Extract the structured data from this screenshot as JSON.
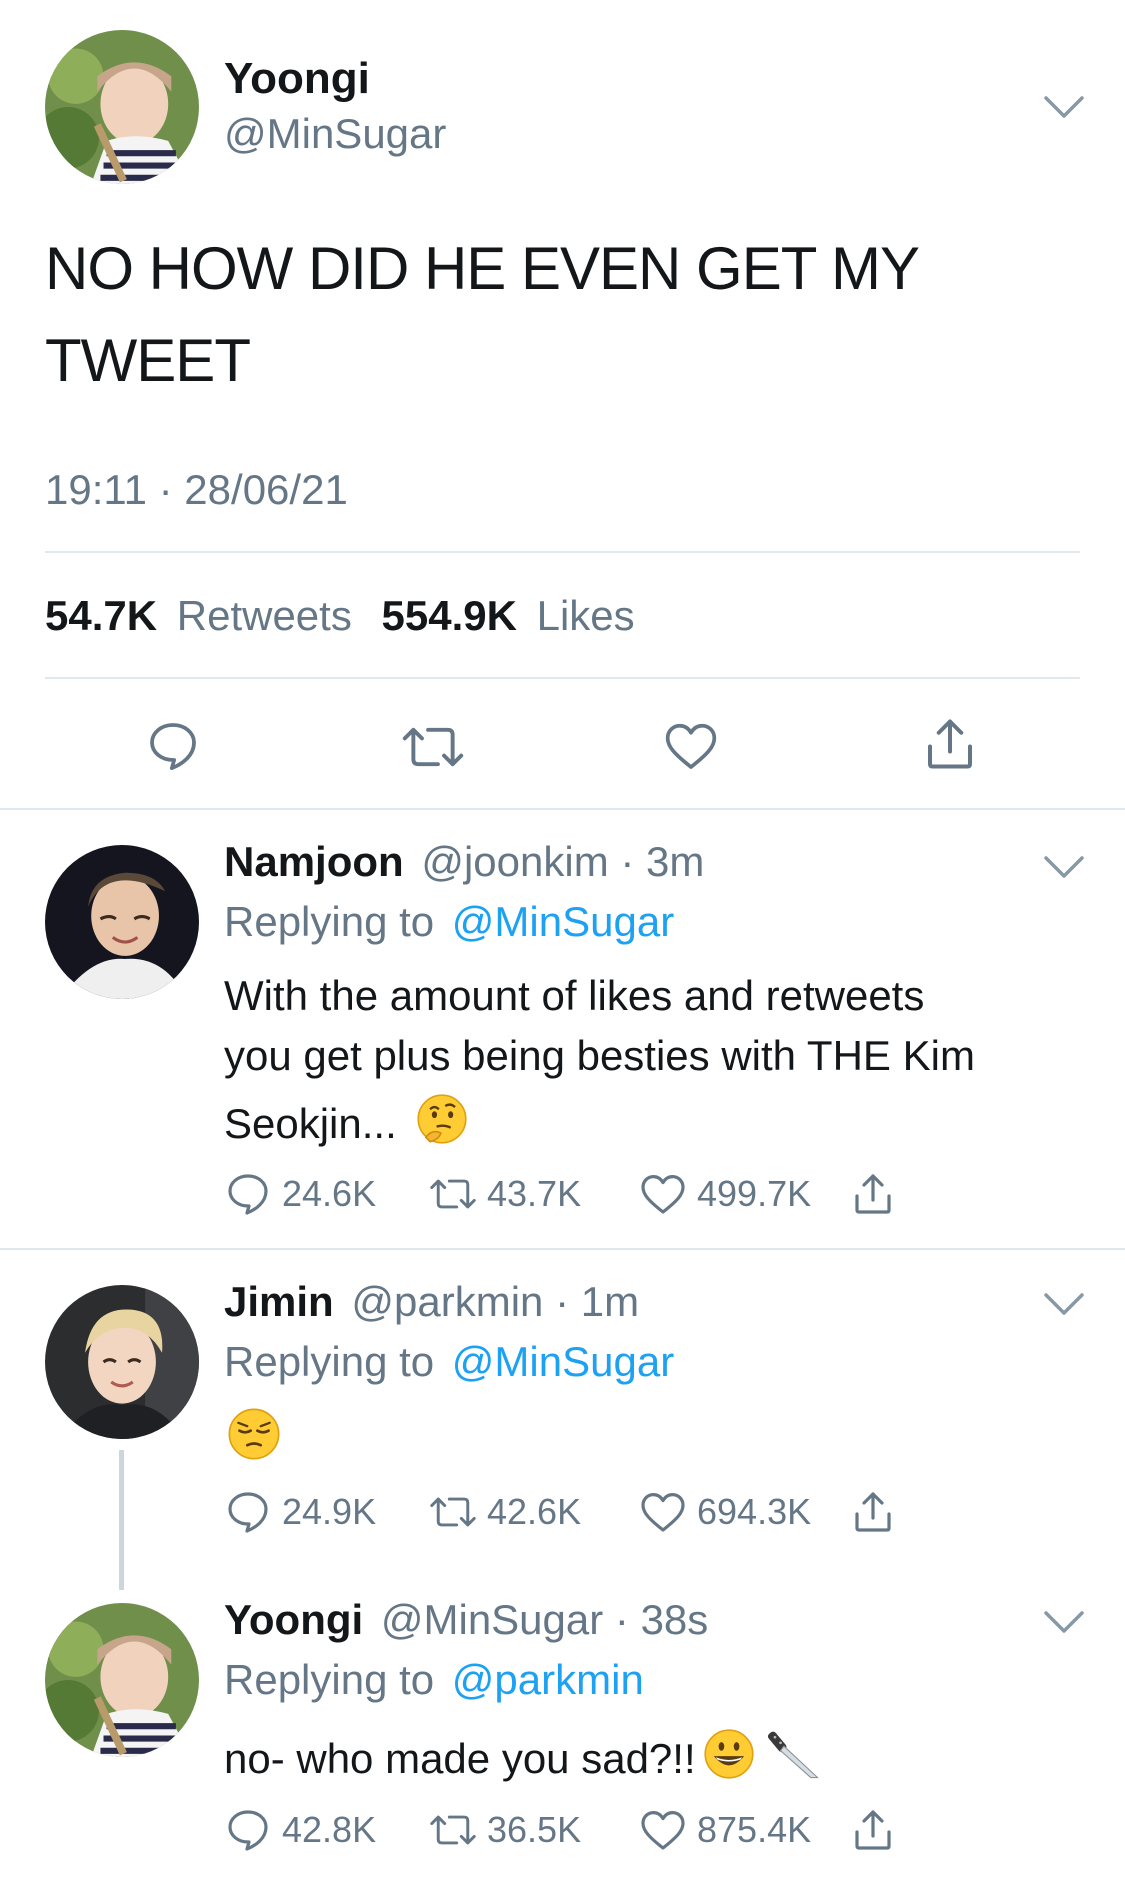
{
  "main_tweet": {
    "name": "Yoongi",
    "handle": "@MinSugar",
    "text_line1": "NO HOW DID HE EVEN GET MY",
    "text_line2": "TWEET",
    "timestamp": "19:11 · 28/06/21",
    "retweets_count": "54.7K",
    "retweets_label": "Retweets",
    "likes_count": "554.9K",
    "likes_label": "Likes"
  },
  "replies": [
    {
      "name": "Namjoon",
      "handle": "@joonkim",
      "time": "· 3m",
      "replying_prefix": "Replying to",
      "replying_to": "@MinSugar",
      "text_line1": "With the amount of likes and retweets",
      "text_line2": "you get plus being besties with THE Kim",
      "text_line3": "Seokjin...",
      "emoji": "thinking-face",
      "replies": "24.6K",
      "retweets": "43.7K",
      "likes": "499.7K"
    },
    {
      "name": "Jimin",
      "handle": "@parkmin",
      "time": "· 1m",
      "replying_prefix": "Replying to",
      "replying_to": "@MinSugar",
      "emoji": "pensive-face",
      "replies": "24.9K",
      "retweets": "42.6K",
      "likes": "694.3K"
    },
    {
      "name": "Yoongi",
      "handle": "@MinSugar",
      "time": "· 38s",
      "replying_prefix": "Replying to",
      "replying_to": "@parkmin",
      "text_line1": "no- who made you sad?!!",
      "emoji": "grinning-face-and-knife",
      "replies": "42.8K",
      "retweets": "36.5K",
      "likes": "875.4K"
    }
  ],
  "colors": {
    "link_blue": "#1da1f2",
    "secondary_grey": "#657786",
    "divider": "#e1e8ed",
    "text": "#14171a"
  }
}
